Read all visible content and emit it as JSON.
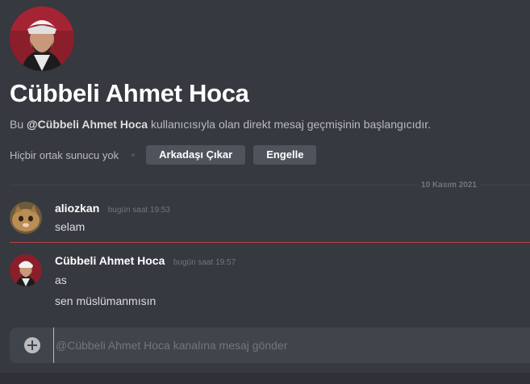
{
  "profile": {
    "name": "Cübbeli Ahmet Hoca",
    "description_prefix": "Bu ",
    "description_mention": "@Cübbeli Ahmet Hoca",
    "description_suffix": " kullanıcısıyla olan direkt mesaj geçmişinin başlangıcıdır.",
    "mutual_servers": "Hiçbir ortak sunucu yok",
    "remove_friend_label": "Arkadaşı Çıkar",
    "block_label": "Engelle"
  },
  "date_divider": "10 Kasım 2021",
  "messages": [
    {
      "author": "aliozkan",
      "time": "bugün saat 19:53",
      "lines": [
        "selam"
      ]
    },
    {
      "author": "Cübbeli Ahmet Hoca",
      "time": "bugün saat 19:57",
      "lines": [
        "as",
        "sen müslümanmısın"
      ]
    }
  ],
  "composer": {
    "placeholder": "@Cübbeli Ahmet Hoca kanalına mesaj gönder"
  },
  "colors": {
    "background": "#36393f",
    "button": "#4f545c",
    "new_message_line": "#ed4245"
  }
}
